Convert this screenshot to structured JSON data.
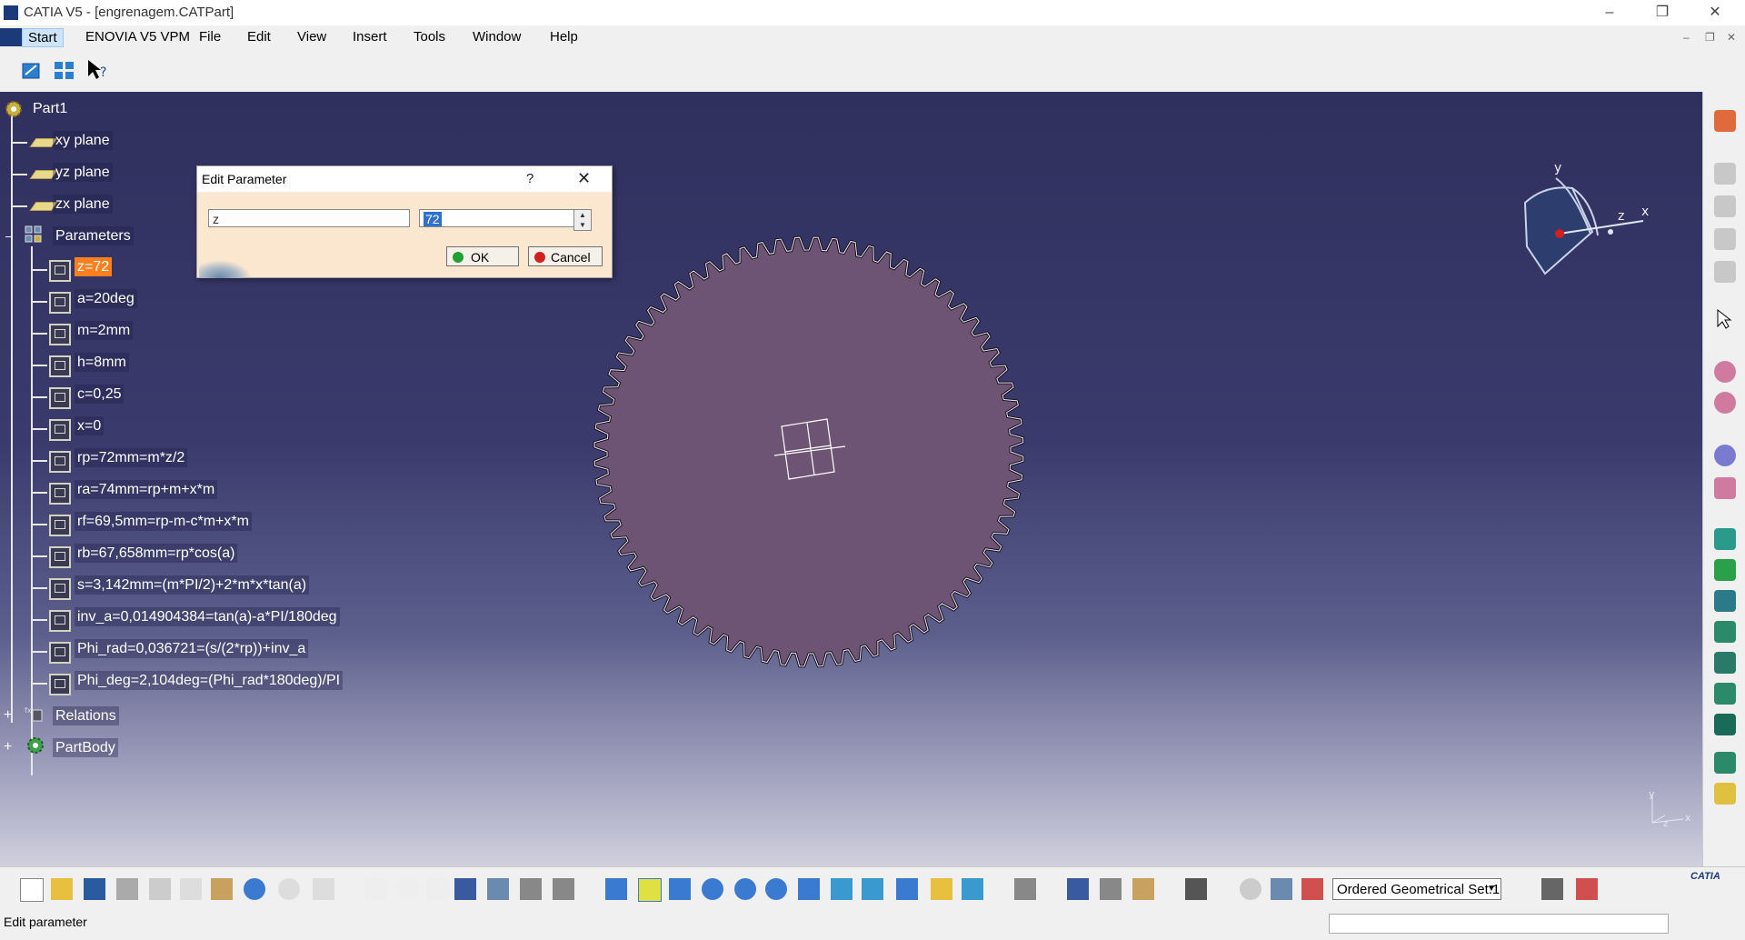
{
  "window": {
    "title": "CATIA V5 - [engrenagem.CATPart]",
    "minimize_glyph": "–",
    "restore_glyph": "❐",
    "close_glyph": "✕"
  },
  "menu": {
    "start": "Start",
    "enovia": "ENOVIA V5 VPM",
    "file": "File",
    "edit": "Edit",
    "view": "View",
    "insert": "Insert",
    "tools": "Tools",
    "window": "Window",
    "help": "Help"
  },
  "tree": {
    "root": "Part1",
    "planes": [
      "xy plane",
      "yz plane",
      "zx plane"
    ],
    "parameters_label": "Parameters",
    "parameters": [
      "z=72",
      "a=20deg",
      "m=2mm",
      "h=8mm",
      "c=0,25",
      "x=0",
      "rp=72mm=m*z/2",
      "ra=74mm=rp+m+x*m",
      "rf=69,5mm=rp-m-c*m+x*m",
      "rb=67,658mm=rp*cos(a)",
      "s=3,142mm=(m*PI/2)+2*m*x*tan(a)",
      "inv_a=0,014904384=tan(a)-a*PI/180deg",
      "Phi_rad=0,036721=(s/(2*rp))+inv_a",
      "Phi_deg=2,104deg=(Phi_rad*180deg)/PI"
    ],
    "relations_label": "Relations",
    "partbody_label": "PartBody"
  },
  "dialog": {
    "title": "Edit Parameter",
    "help_glyph": "?",
    "close_glyph": "✕",
    "name_value": "z",
    "value": "72",
    "ok_label": "OK",
    "cancel_label": "Cancel"
  },
  "compass": {
    "x_label": "x",
    "y_label": "y",
    "z_label": "z"
  },
  "axis_triad": {
    "x_label": "x",
    "y_label": "y",
    "z_label": "z"
  },
  "gear": {
    "teeth": 72,
    "fill_color": "#6e5474",
    "tooth_color": "#e8e8f0"
  },
  "bottom_toolbar": {
    "geometrical_set": "Ordered Geometrical Set.1"
  },
  "status": {
    "text": "Edit parameter"
  },
  "colors": {
    "selection": "#ff7f1e",
    "viewport_top": "#30305e",
    "dialog_bg": "#fbe7d0"
  }
}
